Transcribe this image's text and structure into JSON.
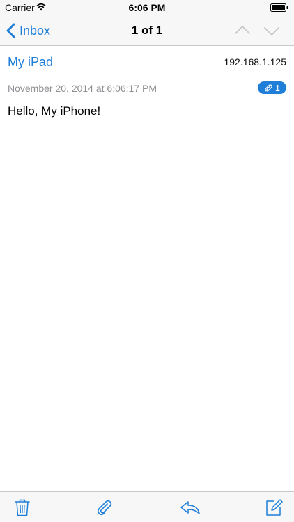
{
  "status_bar": {
    "carrier": "Carrier",
    "time": "6:06 PM"
  },
  "nav": {
    "back_label": "Inbox",
    "title": "1 of 1"
  },
  "message": {
    "sender_name": "My iPad",
    "sender_address": "192.168.1.125",
    "date": "November 20, 2014 at 6:06:17 PM",
    "attachment_count": "1",
    "body": "Hello, My iPhone!"
  },
  "colors": {
    "accent": "#1f7ed8",
    "bar_background": "#f7f7f7",
    "secondary_text": "#8e8e93"
  },
  "icons": {
    "status": [
      "wifi-icon",
      "battery-icon"
    ],
    "nav": [
      "back-chevron-icon",
      "chevron-up-icon",
      "chevron-down-icon"
    ],
    "toolbar": [
      "trash-icon",
      "paperclip-icon",
      "reply-icon",
      "compose-icon"
    ]
  }
}
